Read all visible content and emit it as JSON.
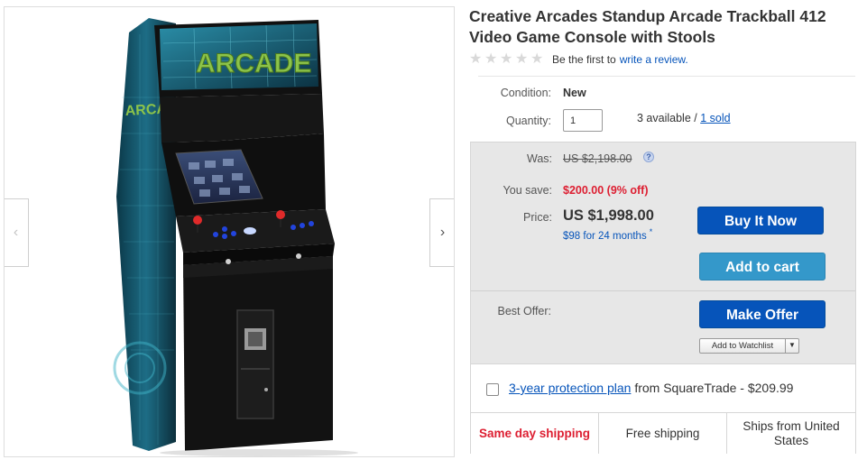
{
  "product": {
    "title": "Creative Arcades Standup Arcade Trackball 412 Video Game Console with Stools",
    "rating_text": "Be the first to",
    "review_link": "write a review.",
    "image_marquee": "ARCADE",
    "image_side_text": "ARCADE"
  },
  "details": {
    "condition_label": "Condition:",
    "condition_value": "New",
    "quantity_label": "Quantity:",
    "quantity_value": "1",
    "available_text": "3 available /",
    "sold_link": "1 sold"
  },
  "pricing": {
    "was_label": "Was:",
    "was_value": "US $2,198.00",
    "help_icon": "?",
    "save_label": "You save:",
    "save_value": "$200.00 (9% off)",
    "price_label": "Price:",
    "price_value": "US $1,998.00",
    "finance_text": "$98 for 24 months",
    "finance_mark": "*",
    "buy_now": "Buy It Now",
    "add_to_cart": "Add to cart",
    "best_offer_label": "Best Offer:",
    "make_offer": "Make Offer",
    "watchlist": "Add to Watchlist"
  },
  "protection": {
    "link": "3-year protection plan",
    "text": "from SquareTrade - $209.99"
  },
  "shipping": {
    "same_day": "Same day shipping",
    "free": "Free shipping",
    "ships_from": "Ships from United States"
  },
  "gallery": {
    "prev": "‹",
    "next": "›"
  },
  "icons": {
    "star": "star-icon",
    "help": "question-circle-icon",
    "chevron_left": "chevron-left-icon",
    "chevron_right": "chevron-right-icon",
    "caret": "caret-down-icon"
  },
  "colors": {
    "link_blue": "#0654ba",
    "buy_blue": "#0654ba",
    "cart_blue": "#3498ca",
    "sale_red": "#dd1e31"
  }
}
